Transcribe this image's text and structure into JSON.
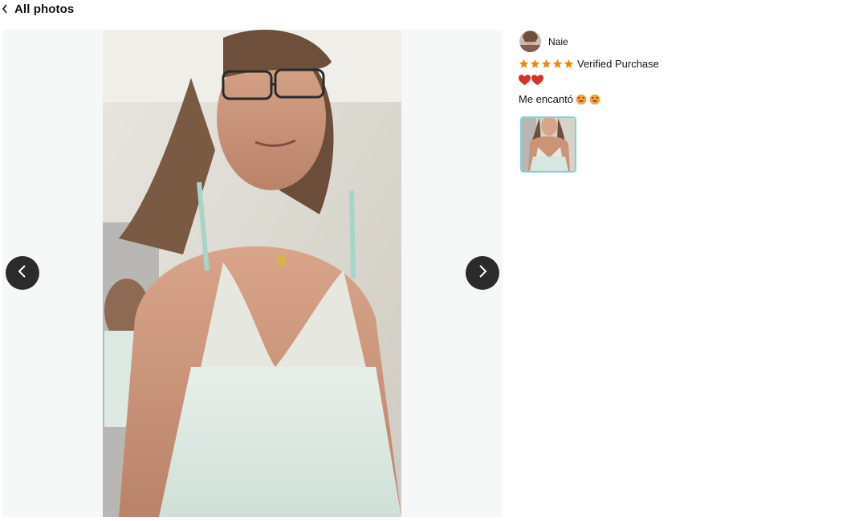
{
  "header": {
    "back_label": "All photos",
    "back_icon": "chevron-left-icon"
  },
  "viewer": {
    "prev_icon": "chevron-left-icon",
    "next_icon": "chevron-right-icon"
  },
  "review": {
    "reviewer_name": "Naie",
    "rating": 5,
    "rating_max": 5,
    "verified_label": "Verified Purchase",
    "title_icons": [
      "heart-icon",
      "heart-icon"
    ],
    "body_text": "Me encantó",
    "body_icons": [
      "heart-eyes-emoji-icon",
      "heart-eyes-emoji-icon"
    ],
    "thumbnails_count": 1
  },
  "colors": {
    "star": "#f08804",
    "heart": "#d7302d",
    "nav_button": "#2b2b2b",
    "viewer_bg": "#f6f8f8",
    "thumb_border": "#7fd3dc"
  }
}
